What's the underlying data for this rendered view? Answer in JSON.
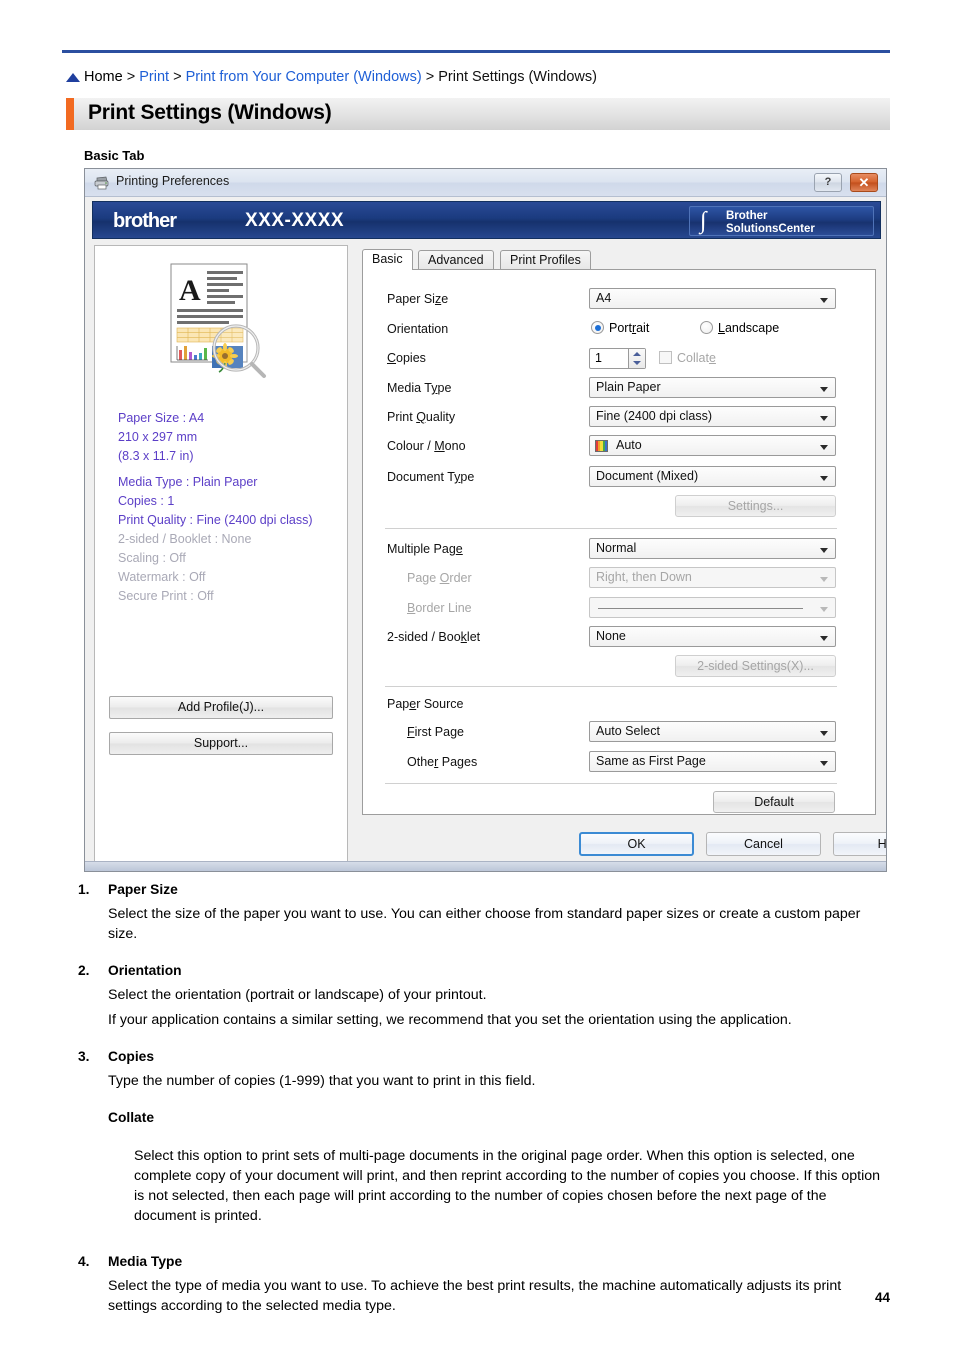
{
  "breadcrumb": {
    "home_icon": "home-icon",
    "items": [
      {
        "label": "Home",
        "link": false
      },
      {
        "label": "Print",
        "link": true
      },
      {
        "label": "Print from Your Computer (Windows)",
        "link": true
      },
      {
        "label": "Print Settings (Windows)",
        "link": false
      }
    ],
    "separator": ">"
  },
  "page_title": "Print Settings (Windows)",
  "section_label": "Basic Tab",
  "page_number": "44",
  "colors": {
    "accent_orange": "#f26a21",
    "link_blue": "#1e5fd6",
    "rule_blue": "#2b4fa0",
    "brother_navy": "#1b3b7f",
    "summary_active": "#5b3ec7",
    "summary_inactive": "#a9a9b6"
  },
  "dialog": {
    "titlebar": {
      "icon": "printer-icon",
      "title": "Printing Preferences",
      "help_button": "?",
      "close_button": "✕"
    },
    "banner": {
      "logo": "brother",
      "model": "XXX-XXXX",
      "solutions_center": {
        "glyph": "∫",
        "line1": "Brother",
        "line2": "SolutionsCenter"
      }
    },
    "preview": {
      "thumbnail": "document-preview-icon",
      "summary": [
        {
          "text": "Paper Size : A4",
          "active": true
        },
        {
          "text": "210 x 297 mm",
          "active": true
        },
        {
          "text": "(8.3 x 11.7 in)",
          "active": true
        },
        {
          "text": "Media Type : Plain Paper",
          "active": true
        },
        {
          "text": "Copies : 1",
          "active": true
        },
        {
          "text": "Print Quality : Fine (2400 dpi class)",
          "active": true
        },
        {
          "text": "2-sided / Booklet : None",
          "active": false
        },
        {
          "text": "Scaling : Off",
          "active": false
        },
        {
          "text": "Watermark : Off",
          "active": false
        },
        {
          "text": "Secure Print : Off",
          "active": false
        }
      ],
      "add_profile_button": "Add Profile(J)...",
      "support_button": "Support..."
    },
    "tabs": [
      {
        "label": "Basic",
        "active": true
      },
      {
        "label": "Advanced",
        "active": false
      },
      {
        "label": "Print Profiles",
        "active": false
      }
    ],
    "form": {
      "paper_size": {
        "label": "Paper Size",
        "value": "A4"
      },
      "orientation": {
        "label": "Orientation",
        "portrait": "Portrait",
        "landscape": "Landscape",
        "selected": "Portrait"
      },
      "copies": {
        "label": "Copies",
        "value": "1",
        "collate_label": "Collate",
        "collate_checked": false
      },
      "media_type": {
        "label": "Media Type",
        "value": "Plain Paper"
      },
      "print_quality": {
        "label": "Print Quality",
        "value": "Fine (2400 dpi class)"
      },
      "colour_mono": {
        "label": "Colour / Mono",
        "value": "Auto",
        "icon": "colour-swatch-icon"
      },
      "document_type": {
        "label": "Document Type",
        "value": "Document (Mixed)"
      },
      "settings_button": "Settings...",
      "multiple_page": {
        "label": "Multiple Page",
        "value": "Normal"
      },
      "page_order": {
        "label": "Page Order",
        "value": "Right, then Down",
        "disabled": true
      },
      "border_line": {
        "label": "Border Line",
        "value": "",
        "disabled": true
      },
      "two_sided": {
        "label": "2-sided / Booklet",
        "value": "None"
      },
      "two_sided_settings_button": "2-sided Settings(X)...",
      "paper_source": {
        "label": "Paper Source"
      },
      "first_page": {
        "label": "First Page",
        "value": "Auto Select"
      },
      "other_pages": {
        "label": "Other Pages",
        "value": "Same as First Page"
      },
      "default_button": "Default"
    },
    "footer": {
      "ok": "OK",
      "cancel": "Cancel",
      "help": "Help"
    }
  },
  "content": {
    "items": [
      {
        "num": "1.",
        "head": "Paper Size",
        "paras": [
          "Select the size of the paper you want to use. You can either choose from standard paper sizes or create a custom paper size."
        ]
      },
      {
        "num": "2.",
        "head": "Orientation",
        "paras": [
          "Select the orientation (portrait or landscape) of your printout.",
          "If your application contains a similar setting, we recommend that you set the orientation using the application."
        ]
      },
      {
        "num": "3.",
        "head": "Copies",
        "paras": [
          "Type the number of copies (1-999) that you want to print in this field."
        ],
        "sub": {
          "head": "Collate",
          "paras": [
            "Select this option to print sets of multi-page documents in the original page order. When this option is selected, one complete copy of your document will print, and then reprint according to the number of copies you choose. If this option is not selected, then each page will print according to the number of copies chosen before the next page of the document is printed."
          ]
        }
      },
      {
        "num": "4.",
        "head": "Media Type",
        "paras": [
          "Select the type of media you want to use. To achieve the best print results, the machine automatically adjusts its print settings according to the selected media type."
        ]
      }
    ]
  }
}
